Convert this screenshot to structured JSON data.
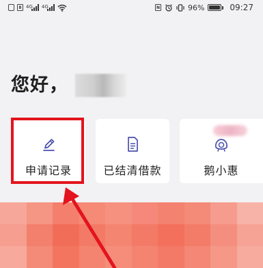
{
  "status_bar": {
    "net_label_1": "4G",
    "net_label_2": "4G",
    "battery": "96%",
    "battery_level": 0.96,
    "time": "09:27"
  },
  "greeting": {
    "text": "您好，"
  },
  "cards": [
    {
      "label": "申请记录",
      "icon": "pencil-icon"
    },
    {
      "label": "已结清借款",
      "icon": "document-icon"
    },
    {
      "label": "鹅小惠",
      "icon": "piggy-bank-icon"
    }
  ],
  "colors": {
    "accent": "#4a4fae",
    "highlight": "#e3141d",
    "banner": "#f58a7a"
  }
}
